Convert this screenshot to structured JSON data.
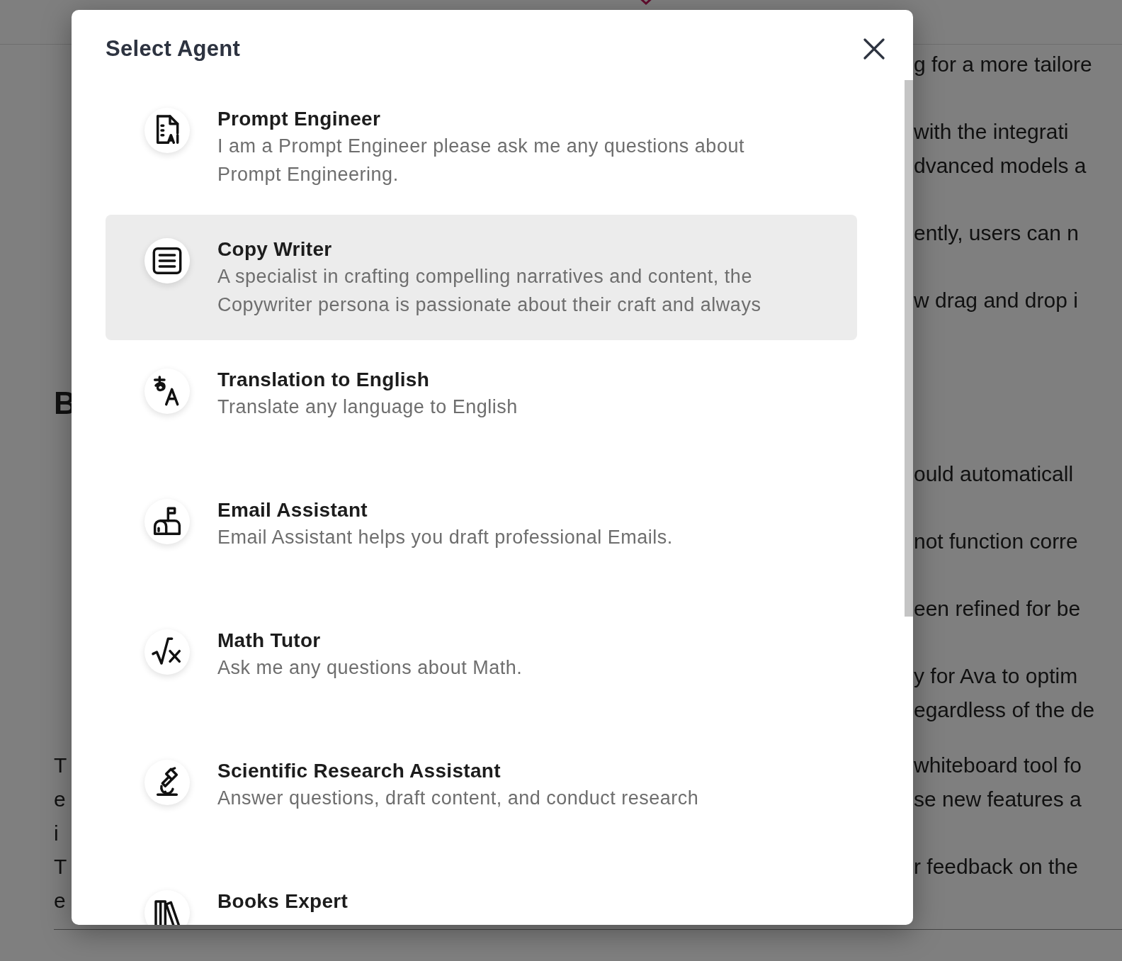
{
  "page": {
    "rows": [
      {
        "right": "g for a more tailore"
      },
      {
        "right": "with the integrati"
      },
      {
        "right": "dvanced models a"
      },
      {
        "right": "ently, users can n"
      },
      {
        "right": "w drag and drop i"
      },
      {
        "left": "B",
        "kind": "heading"
      },
      {
        "right": "ould automaticall"
      },
      {
        "right": "not function corre"
      },
      {
        "right": "een refined for be"
      },
      {
        "right": "y for Ava to optim"
      },
      {
        "right": "egardless of the de"
      },
      {
        "left": "T",
        "right": "whiteboard tool fo",
        "kind": "text"
      },
      {
        "left": "e",
        "right": "se new features a",
        "kind": "text"
      },
      {
        "left": "i",
        "kind": "text"
      },
      {
        "left": "T",
        "right": "r feedback on the",
        "kind": "text"
      },
      {
        "left": "e",
        "kind": "text"
      }
    ]
  },
  "modal": {
    "title": "Select Agent",
    "agents": [
      {
        "name": "Prompt Engineer",
        "description": [
          "I am a Prompt Engineer please ask me any questions about",
          "Prompt Engineering."
        ],
        "kind": "document",
        "selected": false
      },
      {
        "name": "Copy Writer",
        "description": [
          "A specialist in crafting compelling narratives and content, the",
          "Copywriter persona is passionate about their craft and always"
        ],
        "kind": "list",
        "selected": true
      },
      {
        "name": "Translation to English",
        "description": [
          "Translate any language to English"
        ],
        "kind": "translate",
        "selected": false
      },
      {
        "name": "Email Assistant",
        "description": [
          "Email Assistant helps you draft professional Emails."
        ],
        "kind": "mailbox",
        "selected": false
      },
      {
        "name": "Math Tutor",
        "description": [
          "Ask me any questions about Math."
        ],
        "kind": "root",
        "selected": false
      },
      {
        "name": "Scientific Research Assistant",
        "description": [
          "Answer questions, draft content, and conduct research"
        ],
        "kind": "microscope",
        "selected": false
      },
      {
        "name": "Books Expert",
        "kind": "books",
        "selected": false
      }
    ]
  }
}
